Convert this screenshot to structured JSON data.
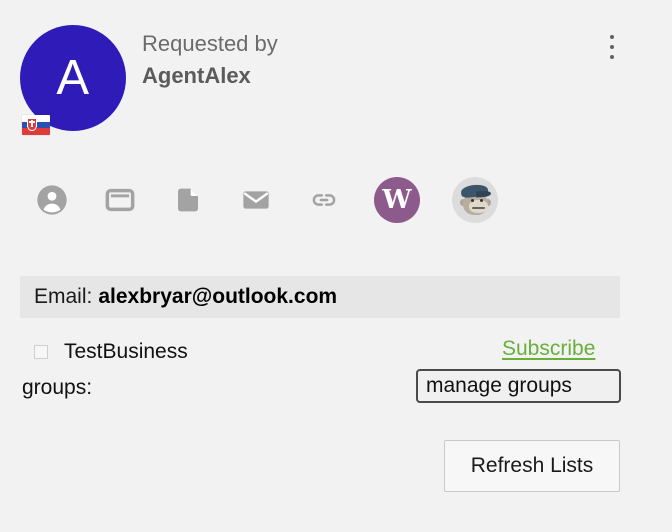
{
  "header": {
    "requested_by_label": "Requested by",
    "requester_name": "AgentAlex",
    "avatar_initial": "A",
    "avatar_color": "#2e1bb8",
    "flag_name": "slovakia-flag",
    "more_menu_label": "more-options"
  },
  "icon_row": {
    "icons": [
      {
        "name": "person-icon",
        "label": "Contact"
      },
      {
        "name": "window-icon",
        "label": "Window"
      },
      {
        "name": "document-icon",
        "label": "Document"
      },
      {
        "name": "mail-icon",
        "label": "Email"
      },
      {
        "name": "link-icon",
        "label": "Link"
      },
      {
        "name": "wordpress-badge-icon",
        "label": "W",
        "color": "#8d5a8c"
      },
      {
        "name": "mailchimp-avatar-icon",
        "label": "Mailchimp",
        "color": "#dcdcdc"
      }
    ]
  },
  "email": {
    "label": "Email:",
    "value": "alexbryar@outlook.com"
  },
  "lists": {
    "rows": [
      {
        "name": "TestBusiness",
        "checked": false,
        "action_label": "Subscribe",
        "action_color": "#6aaf3a"
      }
    ],
    "groups_label": "groups:",
    "manage_groups_label": "manage groups"
  },
  "footer": {
    "refresh_label": "Refresh Lists"
  }
}
